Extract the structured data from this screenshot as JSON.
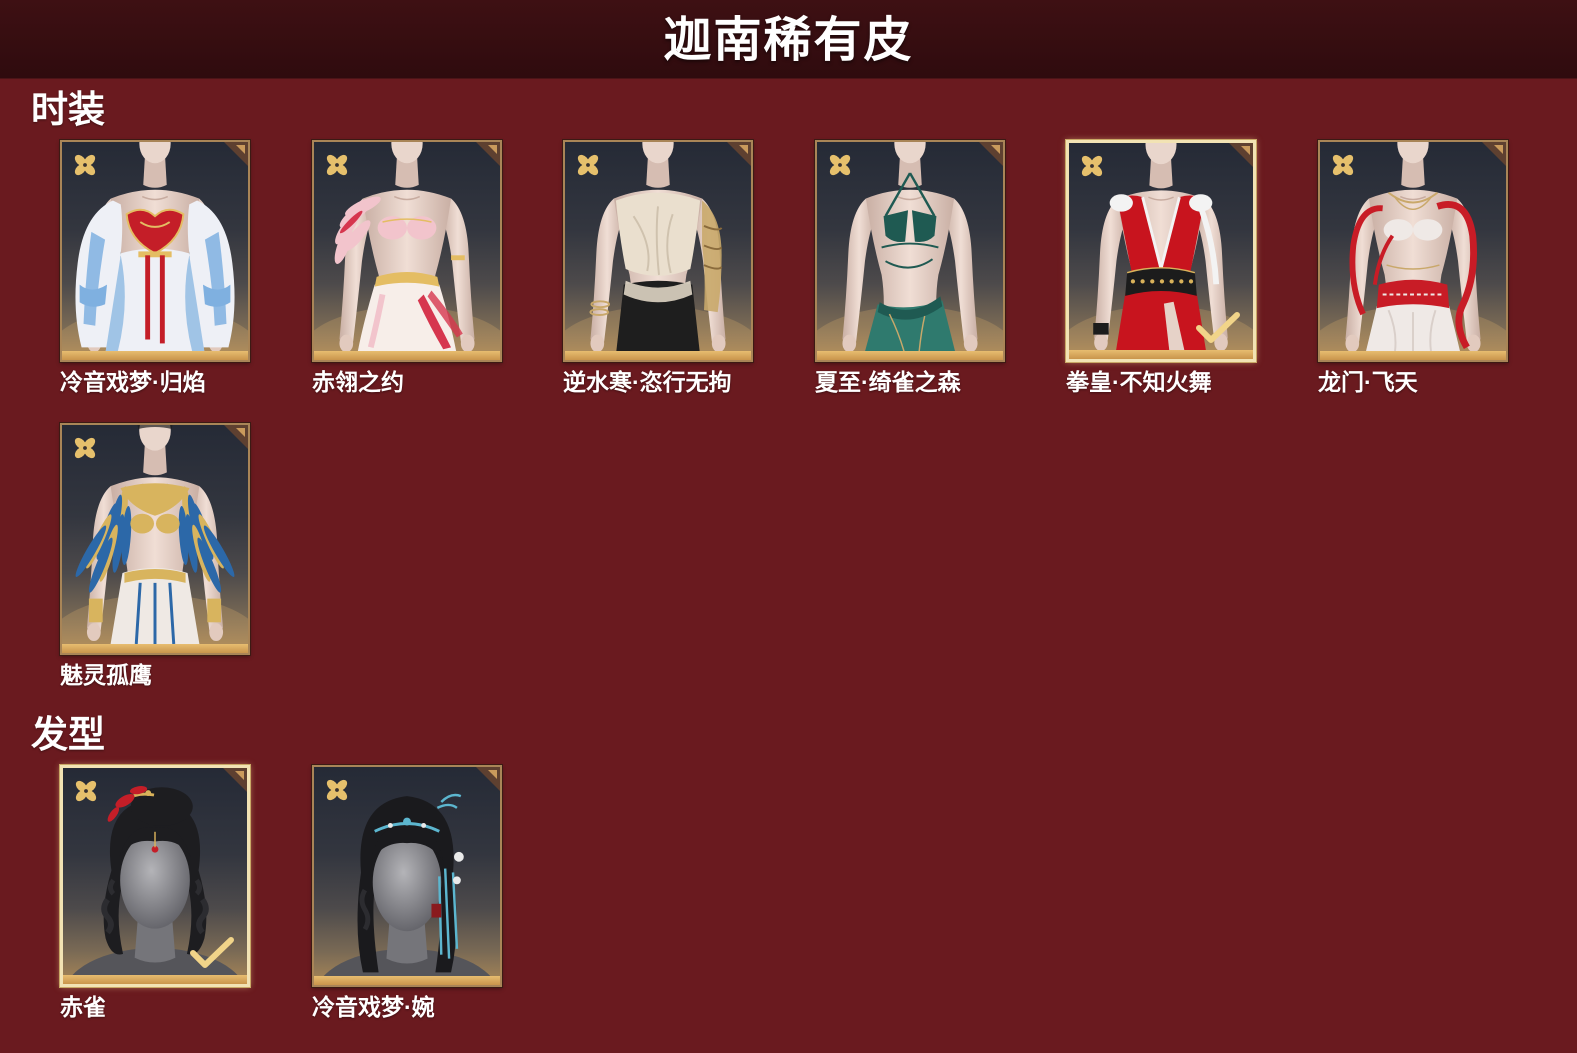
{
  "header": {
    "title": "迦南稀有皮"
  },
  "sections": [
    {
      "title": "时装",
      "items": [
        {
          "name": "冷音戏梦·归焰",
          "selected": false,
          "colors": {
            "primary": "#7fb0e0",
            "secondary": "#eef0f6",
            "accent": "#c41e28"
          }
        },
        {
          "name": "赤翎之约",
          "selected": false,
          "colors": {
            "primary": "#f2c4cc",
            "secondary": "#f7eee9",
            "accent": "#d6364e"
          }
        },
        {
          "name": "逆水寒·恣行无拘",
          "selected": false,
          "colors": {
            "primary": "#eadfce",
            "secondary": "#1e1e1e",
            "accent": "#c9a86a"
          }
        },
        {
          "name": "夏至·绮雀之森",
          "selected": false,
          "colors": {
            "primary": "#1f5a52",
            "secondary": "#2f7a6e",
            "accent": "#c9a86a"
          }
        },
        {
          "name": "拳皇·不知火舞",
          "selected": true,
          "colors": {
            "primary": "#c8141e",
            "secondary": "#f3f3f3",
            "accent": "#1c1c1c"
          }
        },
        {
          "name": "龙门·飞天",
          "selected": false,
          "colors": {
            "primary": "#efe9e6",
            "secondary": "#c81c26",
            "accent": "#c9a86a"
          }
        },
        {
          "name": "魅灵孤鹰",
          "selected": false,
          "colors": {
            "primary": "#2c68a8",
            "secondary": "#d8b45e",
            "accent": "#efe9e4"
          }
        }
      ]
    },
    {
      "title": "发型",
      "items": [
        {
          "name": "赤雀",
          "selected": true,
          "colors": {
            "primary": "#1d1d20",
            "secondary": "#d9b25a",
            "accent": "#c41e28"
          }
        },
        {
          "name": "冷音戏梦·婉",
          "selected": false,
          "colors": {
            "primary": "#1a1a1d",
            "secondary": "#eaeaea",
            "accent": "#5cb6cf"
          }
        }
      ]
    }
  ],
  "icons": {
    "badge": "flower-badge-icon",
    "corner": "corner-ornament-icon",
    "selected": "checkmark-icon"
  },
  "theme": {
    "background": "#6a1a1f",
    "header": "#360d10",
    "card_border": "#a98557",
    "card_selected_border": "#f2e3b4",
    "gold": "#e7bd70"
  }
}
